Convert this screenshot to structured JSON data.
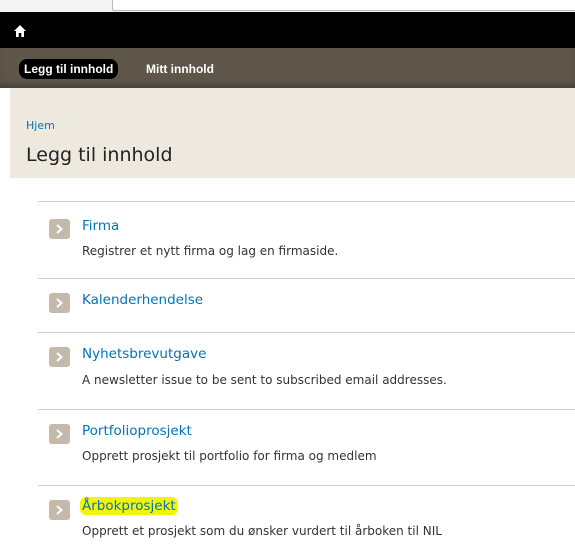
{
  "toolbar": {
    "home_icon": "home-icon"
  },
  "shortcuts": [
    {
      "label": "Legg til innhold",
      "active": true
    },
    {
      "label": "Mitt innhold",
      "active": false
    }
  ],
  "breadcrumb": {
    "label": "Hjem"
  },
  "page_title": "Legg til innhold",
  "content_types": [
    {
      "title": "Firma",
      "description": "Registrer et nytt firma og lag en firmaside."
    },
    {
      "title": "Kalenderhendelse",
      "description": ""
    },
    {
      "title": "Nyhetsbrevutgave",
      "description": "A newsletter issue to be sent to subscribed email addresses."
    },
    {
      "title": "Portfolioprosjekt",
      "description": "Opprett prosjekt til portfolio for firma og medlem"
    },
    {
      "title": "Årbokprosjekt",
      "description": "Opprett et prosjekt som du ønsker vurdert til årboken til NIL",
      "highlighted": true
    }
  ],
  "colors": {
    "toolbar_bg": "#000000",
    "shortcuts_bg": "#5e5749",
    "header_bg": "#ede9df",
    "link": "#0074bd",
    "arrow_bg": "#c5b9ac",
    "highlight": "#f3f30c"
  }
}
